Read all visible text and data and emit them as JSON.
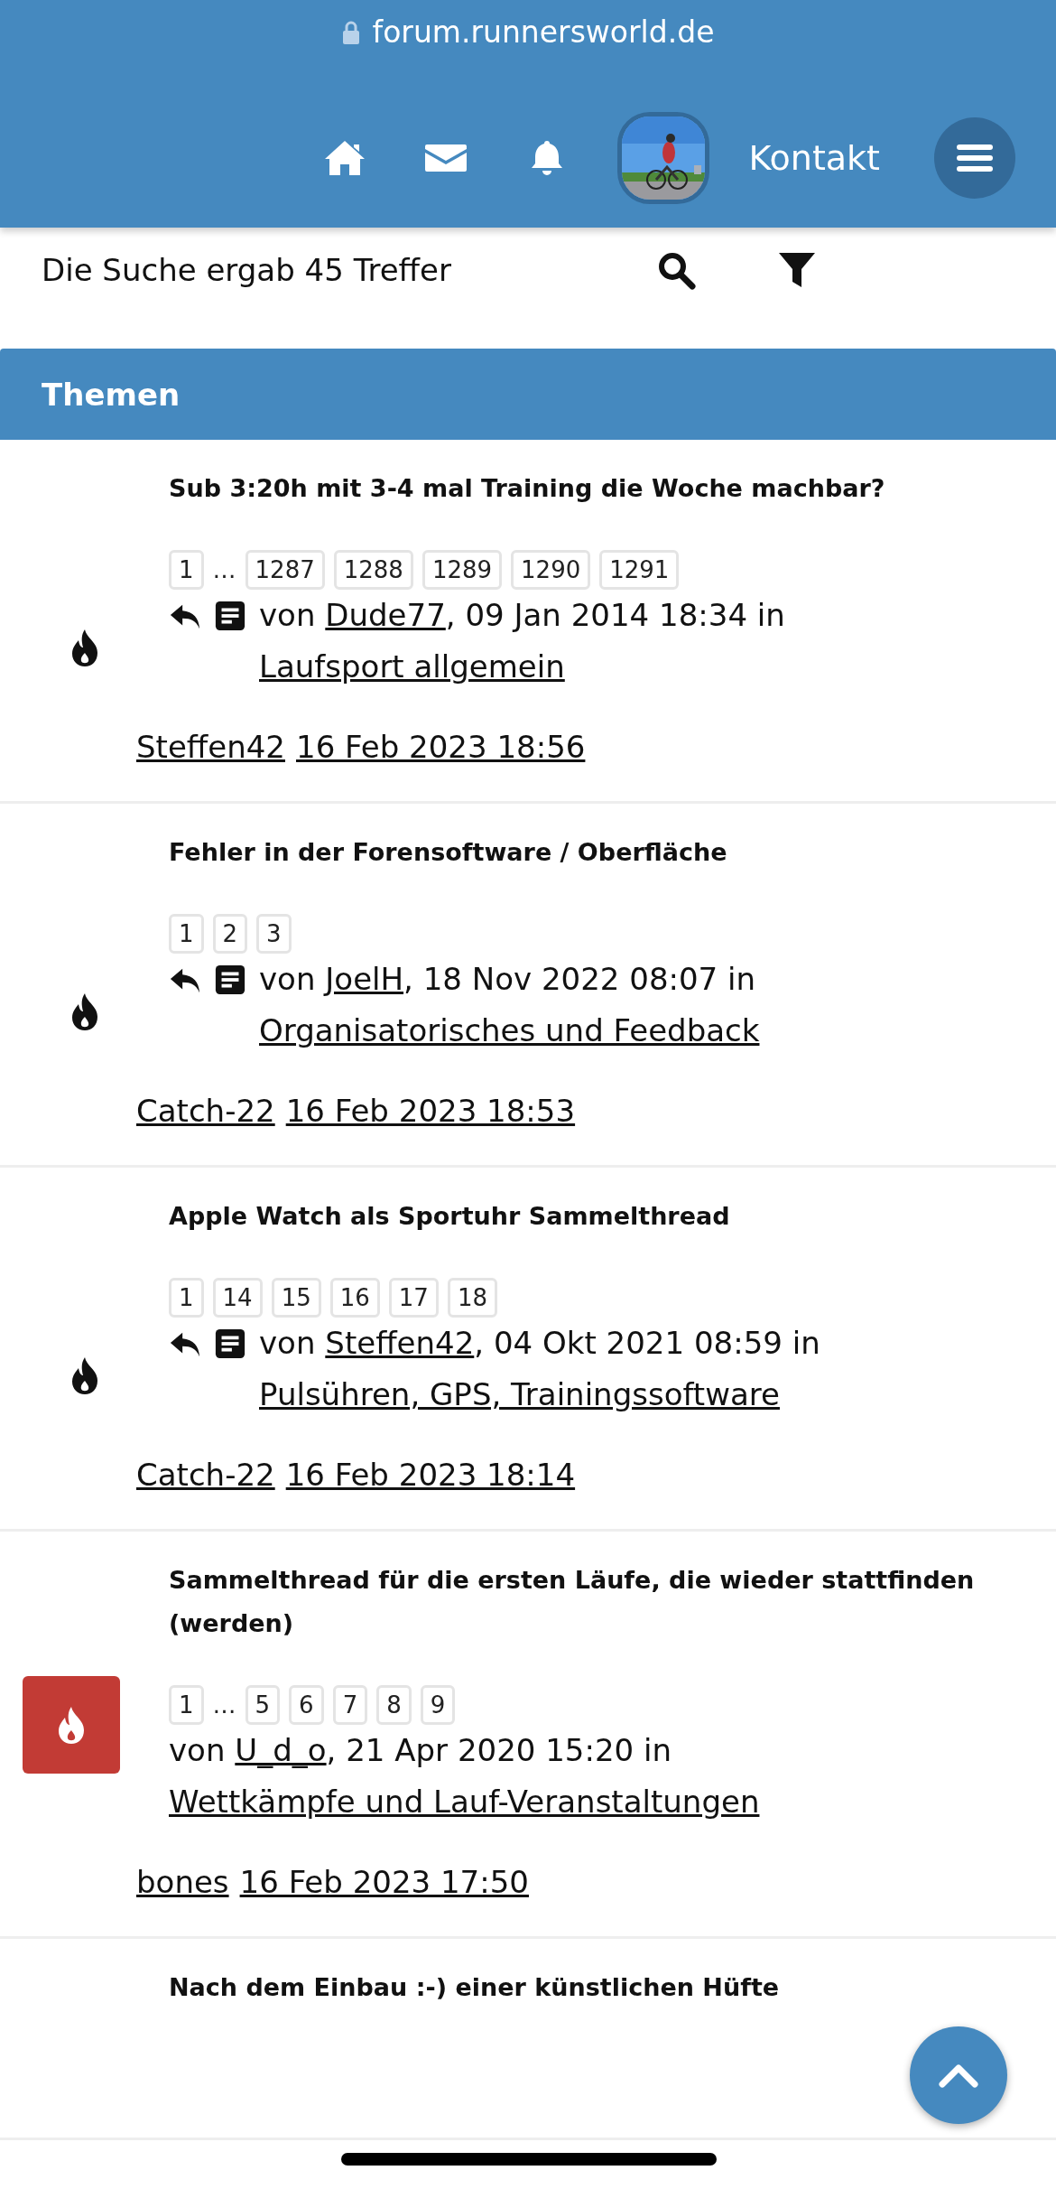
{
  "url": "forum.runnersworld.de",
  "nav": {
    "contact": "Kontakt"
  },
  "search": {
    "summary": "Die Suche ergab 45 Treffer"
  },
  "section": {
    "title": "Themen"
  },
  "topics": [
    {
      "title": "Sub 3:20h mit 3-4 mal Training die Woche machbar?",
      "hot": false,
      "replied": true,
      "pages": [
        {
          "kind": "page",
          "label": "1"
        },
        {
          "kind": "gap",
          "label": "…"
        },
        {
          "kind": "page",
          "label": "1287"
        },
        {
          "kind": "page",
          "label": "1288"
        },
        {
          "kind": "page",
          "label": "1289"
        },
        {
          "kind": "page",
          "label": "1290"
        },
        {
          "kind": "page",
          "label": "1291"
        }
      ],
      "by": "von",
      "author": "Dude77",
      "date": ", 09 Jan 2014 18:34 in",
      "forum": "Laufsport allgemein",
      "last_user": "Steffen42",
      "last_date": "16 Feb 2023 18:56"
    },
    {
      "title": "Fehler in der Forensoftware / Oberfläche",
      "hot": false,
      "replied": true,
      "pages": [
        {
          "kind": "page",
          "label": "1"
        },
        {
          "kind": "page",
          "label": "2"
        },
        {
          "kind": "page",
          "label": "3"
        }
      ],
      "by": "von",
      "author": "JoelH",
      "date": ", 18 Nov 2022 08:07 in",
      "forum": "Organisatorisches und Feedback",
      "last_user": "Catch-22",
      "last_date": "16 Feb 2023 18:53"
    },
    {
      "title": "Apple Watch als Sportuhr Sammelthread",
      "hot": false,
      "replied": true,
      "pages": [
        {
          "kind": "page",
          "label": "1"
        },
        {
          "kind": "page",
          "label": "14"
        },
        {
          "kind": "page",
          "label": "15"
        },
        {
          "kind": "page",
          "label": "16"
        },
        {
          "kind": "page",
          "label": "17"
        },
        {
          "kind": "page",
          "label": "18"
        }
      ],
      "by": "von",
      "author": "Steffen42",
      "date": ", 04 Okt 2021 08:59 in",
      "forum": "Pulsühren, GPS, Trainingssoftware",
      "last_user": "Catch-22",
      "last_date": "16 Feb 2023 18:14"
    },
    {
      "title": "Sammelthread für die ersten Läufe, die wieder stattfinden (werden)",
      "hot": true,
      "replied": false,
      "pages": [
        {
          "kind": "page",
          "label": "1"
        },
        {
          "kind": "gap",
          "label": "…"
        },
        {
          "kind": "page",
          "label": "5"
        },
        {
          "kind": "page",
          "label": "6"
        },
        {
          "kind": "page",
          "label": "7"
        },
        {
          "kind": "page",
          "label": "8"
        },
        {
          "kind": "page",
          "label": "9"
        }
      ],
      "by": "von",
      "author": "U_d_o",
      "date": ", 21 Apr 2020 15:20 in",
      "forum": "Wettkämpfe und Lauf-Veranstaltungen",
      "last_user": "bones",
      "last_date": "16 Feb 2023 17:50"
    },
    {
      "title": "Nach dem Einbau :-) einer künstlichen Hüfte"
    }
  ]
}
